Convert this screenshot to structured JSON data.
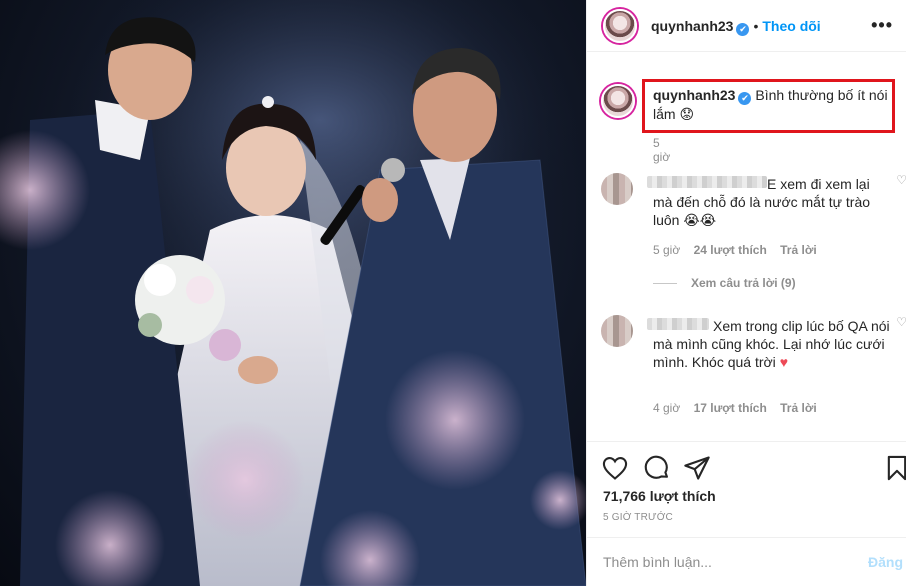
{
  "post": {
    "username": "quynhanh23",
    "follow_separator": "•",
    "follow_label": "Theo dõi",
    "more_icon": "•••",
    "verified_icon": "✔"
  },
  "caption": {
    "username": "quynhanh23",
    "text": "Bình thường bố ít nói lắm",
    "emoji": "😟",
    "time": "5 giờ"
  },
  "comments": [
    {
      "text": "E xem đi xem lại mà đến chỗ đó là nước mắt tự trào luôn",
      "emoji": "😭😭",
      "time": "5 giờ",
      "likes": "24 lượt thích",
      "reply": "Trả lời",
      "view_replies": "Xem câu trả lời (9)"
    },
    {
      "text": "Xem trong clip lúc bố QA nói mà mình cũng khóc. Lại nhớ lúc cưới mình. Khóc quá trời",
      "emoji": "♥",
      "time": "4 giờ",
      "likes": "17 lượt thích",
      "reply": "Trả lời"
    }
  ],
  "actions": {
    "likes": "71,766 lượt thích",
    "posted": "5 GIỜ TRƯỚC"
  },
  "comment_box": {
    "placeholder": "Thêm bình luận...",
    "post_label": "Đăng"
  },
  "colors": {
    "accent": "#0095f6",
    "highlight": "#e0151c",
    "heart": "#ed4956"
  }
}
